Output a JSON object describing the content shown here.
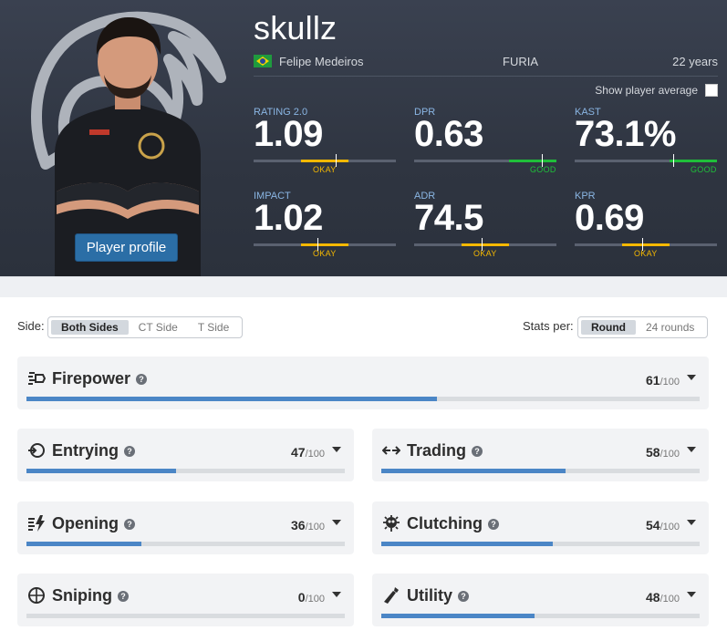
{
  "player": {
    "nickname": "skullz",
    "real_name": "Felipe Medeiros",
    "team": "FURIA",
    "age": "22 years",
    "country_flag": "brazil-flag",
    "profile_button": "Player profile",
    "show_average_label": "Show player average"
  },
  "headline_stats": [
    {
      "label": "RATING 2.0",
      "value": "1.09",
      "rating": "OKAY",
      "color": "#f5b800"
    },
    {
      "label": "DPR",
      "value": "0.63",
      "rating": "GOOD",
      "color": "#1fbf3a"
    },
    {
      "label": "KAST",
      "value": "73.1%",
      "rating": "GOOD",
      "color": "#1fbf3a"
    },
    {
      "label": "IMPACT",
      "value": "1.02",
      "rating": "OKAY",
      "color": "#f5b800"
    },
    {
      "label": "ADR",
      "value": "74.5",
      "rating": "OKAY",
      "color": "#f5b800"
    },
    {
      "label": "KPR",
      "value": "0.69",
      "rating": "OKAY",
      "color": "#f5b800"
    }
  ],
  "filters": {
    "side_label": "Side:",
    "side_options": [
      "Both Sides",
      "CT Side",
      "T Side"
    ],
    "side_selected": "Both Sides",
    "stats_per_label": "Stats per:",
    "stats_per_options": [
      "Round",
      "24 rounds"
    ],
    "stats_per_selected": "Round"
  },
  "categories": [
    {
      "name": "Firepower",
      "score": 61,
      "max": "/100",
      "icon": "firepower-icon"
    },
    {
      "name": "Entrying",
      "score": 47,
      "max": "/100",
      "icon": "entrying-icon"
    },
    {
      "name": "Trading",
      "score": 58,
      "max": "/100",
      "icon": "trading-icon"
    },
    {
      "name": "Opening",
      "score": 36,
      "max": "/100",
      "icon": "opening-icon"
    },
    {
      "name": "Clutching",
      "score": 54,
      "max": "/100",
      "icon": "clutching-icon"
    },
    {
      "name": "Sniping",
      "score": 0,
      "max": "/100",
      "icon": "sniping-icon"
    },
    {
      "name": "Utility",
      "score": 48,
      "max": "/100",
      "icon": "utility-icon"
    }
  ],
  "colors": {
    "accent": "#4b86c6",
    "okay": "#f5b800",
    "good": "#1fbf3a",
    "button": "#2b6ea6"
  }
}
